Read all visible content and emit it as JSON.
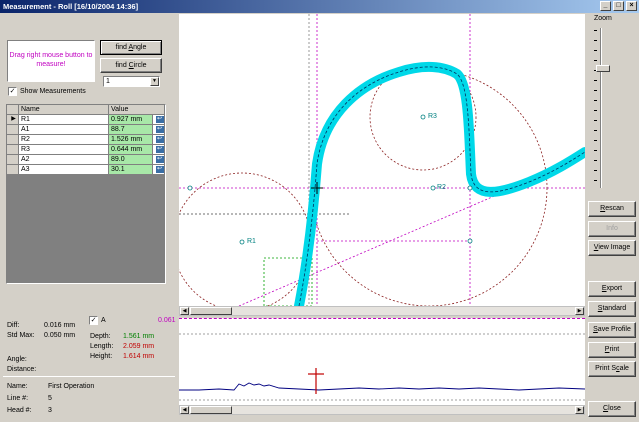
{
  "window": {
    "title": "Measurement - Roll [16/10/2004 14:36]",
    "min": "_",
    "max": "□",
    "close": "×"
  },
  "left": {
    "drag_hint": "Drag right mouse button to measure!",
    "find_angle_pre": "find ",
    "find_angle_u": "A",
    "find_angle_post": "ngle",
    "find_circle_pre": "find ",
    "find_circle_u": "C",
    "find_circle_post": "ircle",
    "combo_value": "1",
    "show_measurements": "Show Measurements",
    "show_measurements_checked": true,
    "grid": {
      "col_name": "Name",
      "col_value": "Value",
      "rows": [
        {
          "name": "R1",
          "value": "0.927 mm"
        },
        {
          "name": "A1",
          "value": "88.7"
        },
        {
          "name": "R2",
          "value": "1.526 mm"
        },
        {
          "name": "R3",
          "value": "0.644 mm"
        },
        {
          "name": "A2",
          "value": "89.0"
        },
        {
          "name": "A3",
          "value": "30.1"
        }
      ]
    },
    "stats": {
      "diff_label": "Diff:",
      "diff_value": "0.016 mm",
      "stdmax_label": "Std Max:",
      "stdmax_value": "0.050 mm",
      "angle_label": "Angle:",
      "distance_label": "Distance:"
    },
    "legendA": {
      "label": "A",
      "checked": true,
      "value": "0.061",
      "depth_label": "Depth:",
      "depth_value": "1.561 mm",
      "length_label": "Length:",
      "length_value": "2.059 mm",
      "height_label": "Height:",
      "height_value": "1.614 mm"
    },
    "footer": {
      "name_label": "Name:",
      "name_value": "First Operation",
      "line_label": "Line #:",
      "line_value": "5",
      "head_label": "Head #:",
      "head_value": "3"
    }
  },
  "canvas": {
    "labels": {
      "r1": "R1",
      "r2": "R2",
      "r3": "R3"
    }
  },
  "right": {
    "zoom_label": "Zoom",
    "zoom_level": 0.25,
    "buttons": {
      "rescan_u": "R",
      "rescan_rest": "escan",
      "info": "Info",
      "view_u": "V",
      "view_rest": "iew Image",
      "export_u": "E",
      "export_rest": "xport",
      "standard_u": "S",
      "standard_rest": "tandard",
      "save_u": "S",
      "save_rest": "ave Profile",
      "print_u": "P",
      "print_rest": "rint",
      "printscale_pre": "Print S",
      "printscale_u": "c",
      "printscale_post": "ale",
      "close_u": "C",
      "close_rest": "lose"
    }
  },
  "colors": {
    "accent": "#0a246a",
    "profile": "#00d8e8",
    "value_bg": "#a8e8a8",
    "hint": "#c000c0"
  }
}
